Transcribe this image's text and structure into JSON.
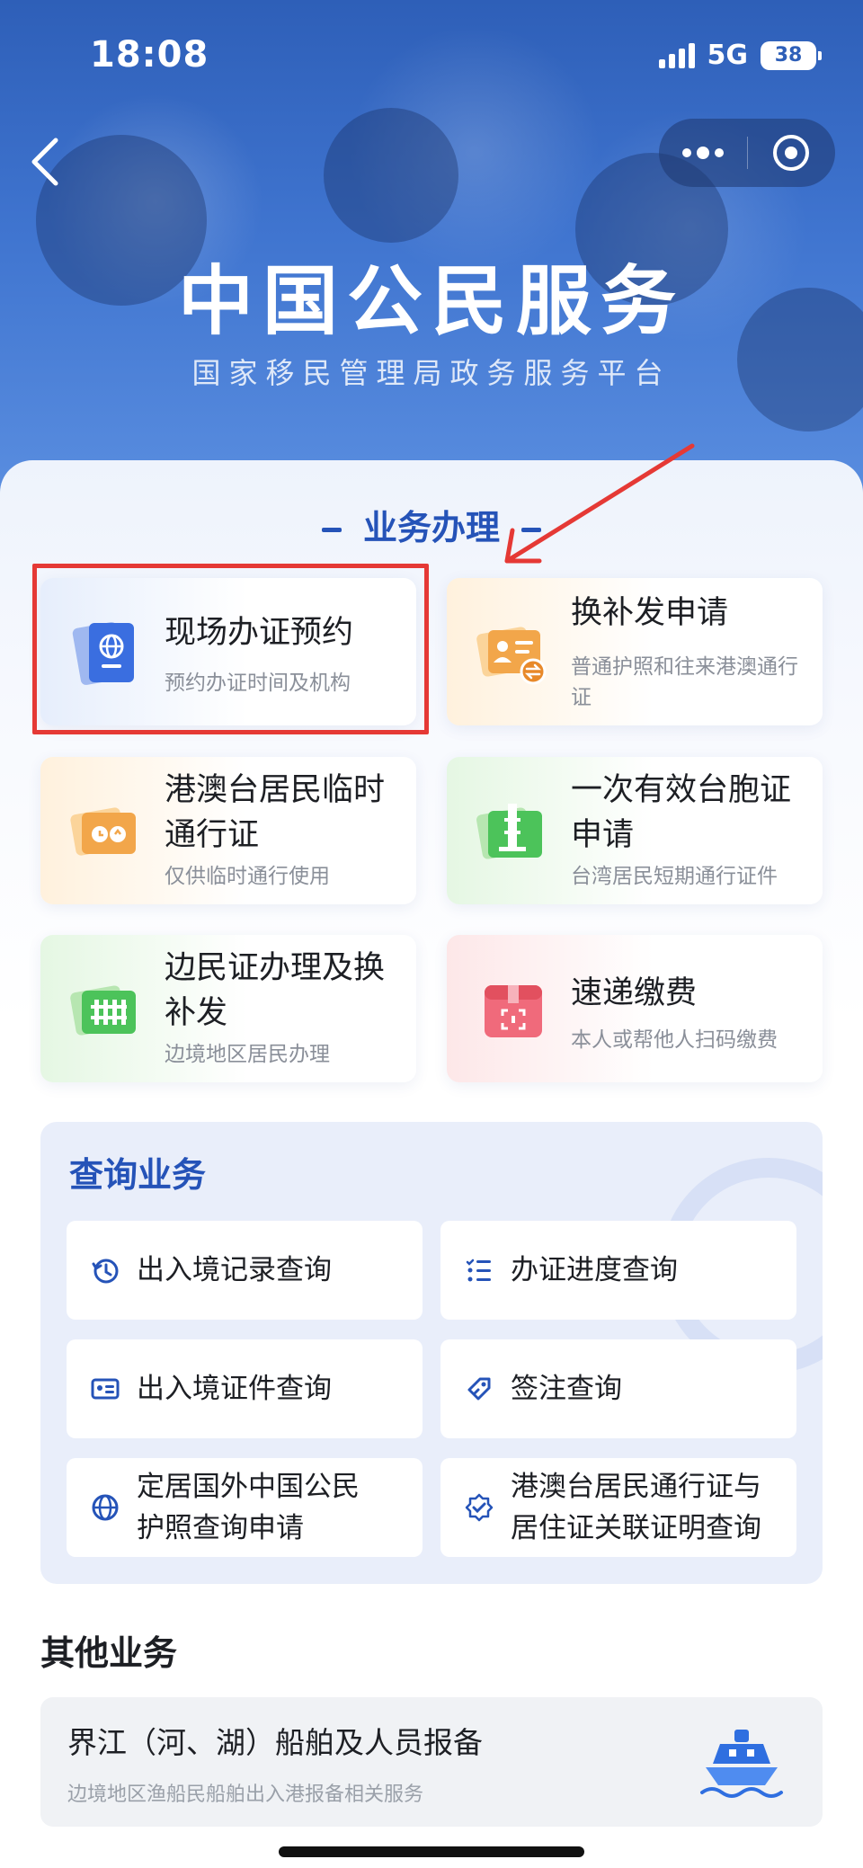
{
  "status_bar": {
    "time": "18:08",
    "network": "5G",
    "battery": "38"
  },
  "header": {
    "title": "中国公民服务",
    "subtitle": "国家移民管理局政务服务平台"
  },
  "business": {
    "section_title": "业务办理",
    "items": [
      {
        "title": "现场办证预约",
        "desc": "预约办证时间及机构"
      },
      {
        "title": "换补发申请",
        "desc": "普通护照和往来港澳通行证"
      },
      {
        "title": "港澳台居民临时通行证",
        "desc": "仅供临时通行使用"
      },
      {
        "title": "一次有效台胞证申请",
        "desc": "台湾居民短期通行证件"
      },
      {
        "title": "边民证办理及换补发",
        "desc": "边境地区居民办理"
      },
      {
        "title": "速递缴费",
        "desc": "本人或帮他人扫码缴费"
      }
    ]
  },
  "query": {
    "title": "查询业务",
    "items": [
      {
        "label": "出入境记录查询"
      },
      {
        "label": "办证进度查询"
      },
      {
        "label": "出入境证件查询"
      },
      {
        "label": "签注查询"
      },
      {
        "label": "定居国外中国公民护照查询申请"
      },
      {
        "label": "港澳台居民通行证与居住证关联证明查询"
      }
    ]
  },
  "other": {
    "title": "其他业务",
    "item": {
      "name": "界江（河、湖）船舶及人员报备",
      "desc": "边境地区渔船民船舶出入港报备相关服务"
    }
  },
  "colors": {
    "brand_blue": "#2553b8",
    "highlight_red": "#e53935"
  },
  "icons": {
    "svc": [
      "passport-icon",
      "id-card-swap-icon",
      "pass-clock-icon",
      "tower-card-icon",
      "fence-card-icon",
      "parcel-qr-icon"
    ],
    "query": [
      "history-clock-icon",
      "checklist-icon",
      "id-card-icon",
      "tag-edit-icon",
      "globe-icon",
      "badge-check-icon"
    ],
    "other": "ship-icon"
  }
}
